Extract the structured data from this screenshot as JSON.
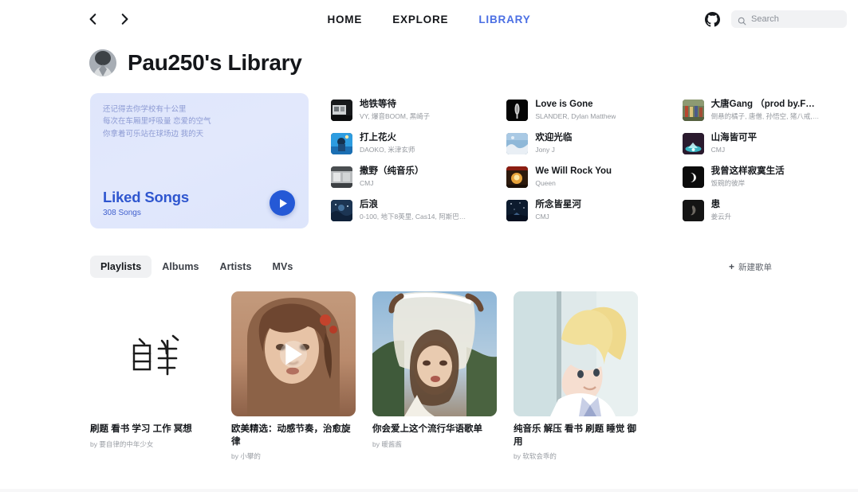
{
  "topbar": {
    "back_icon": "chevron-left-icon",
    "forward_icon": "chevron-right-icon",
    "nav": [
      {
        "label": "HOME",
        "active": false
      },
      {
        "label": "EXPLORE",
        "active": false
      },
      {
        "label": "LIBRARY",
        "active": true
      }
    ],
    "github_icon": "github-icon",
    "search": {
      "icon": "search-icon",
      "placeholder": "Search",
      "value": ""
    }
  },
  "header": {
    "avatar": "user-avatar",
    "title": "Pau250's Library"
  },
  "liked_card": {
    "lyrics": "还记得去你学校有十公里\n每次在车厢里呼吸量 恋爱的空气\n你拿着可乐站在球场边 我的天",
    "lyric_lines": [
      "还记得去你学校有十公里",
      "每次在车厢里呼吸量 恋爱的空气",
      "你拿着可乐站在球场边 我的天"
    ],
    "name": "Liked Songs",
    "count": "308 Songs",
    "play_icon": "play-icon",
    "accent": "#2559d6"
  },
  "songs": {
    "columns": [
      [
        {
          "title": "地铁等待",
          "artist": "VY, 爆音BOOM, 黑崎子"
        },
        {
          "title": "打上花火",
          "artist": "DAOKO, 米津玄师"
        },
        {
          "title": "撒野（纯音乐）",
          "artist": "CMJ"
        },
        {
          "title": "后浪",
          "artist": "0-100, 地下8英里, Cas14, 阿斯巴…"
        }
      ],
      [
        {
          "title": "Love is Gone",
          "artist": "SLANDER, Dylan Matthew"
        },
        {
          "title": "欢迎光临",
          "artist": "Jony J"
        },
        {
          "title": "We Will Rock You",
          "artist": "Queen"
        },
        {
          "title": "所念皆星河",
          "artist": "CMJ"
        }
      ],
      [
        {
          "title": "大唐Gang （prod by.F…",
          "artist": "倒悬的橘子, 唐僧, 孙悟空, 猪八戒,…"
        },
        {
          "title": "山海皆可平",
          "artist": "CMJ"
        },
        {
          "title": "我曾这样寂寞生活",
          "artist": "饭碗的彼岸"
        },
        {
          "title": "患",
          "artist": "姜云升"
        }
      ]
    ]
  },
  "tabs": [
    {
      "label": "Playlists",
      "active": true
    },
    {
      "label": "Albums",
      "active": false
    },
    {
      "label": "Artists",
      "active": false
    },
    {
      "label": "MVs",
      "active": false
    }
  ],
  "new_playlist": {
    "icon": "plus-icon",
    "label": "新建歌单"
  },
  "playlists": [
    {
      "title": "刷题 看书 学习 工作 冥想",
      "by": "by 要自律的中年少女",
      "art": "calligraphy",
      "playing": false
    },
    {
      "title": "欧美精选：动感节奏，治愈旋律",
      "by": "by 小攀的",
      "art": "portrait-warm",
      "playing": true
    },
    {
      "title": "你会爱上这个流行华语歌单",
      "by": "by 暖酱酱",
      "art": "portrait-lace",
      "playing": false
    },
    {
      "title": "纯音乐 解压 看书 刷题 睡觉 御用",
      "by": "by 软软会乖的",
      "art": "anime-boy",
      "playing": false
    }
  ]
}
